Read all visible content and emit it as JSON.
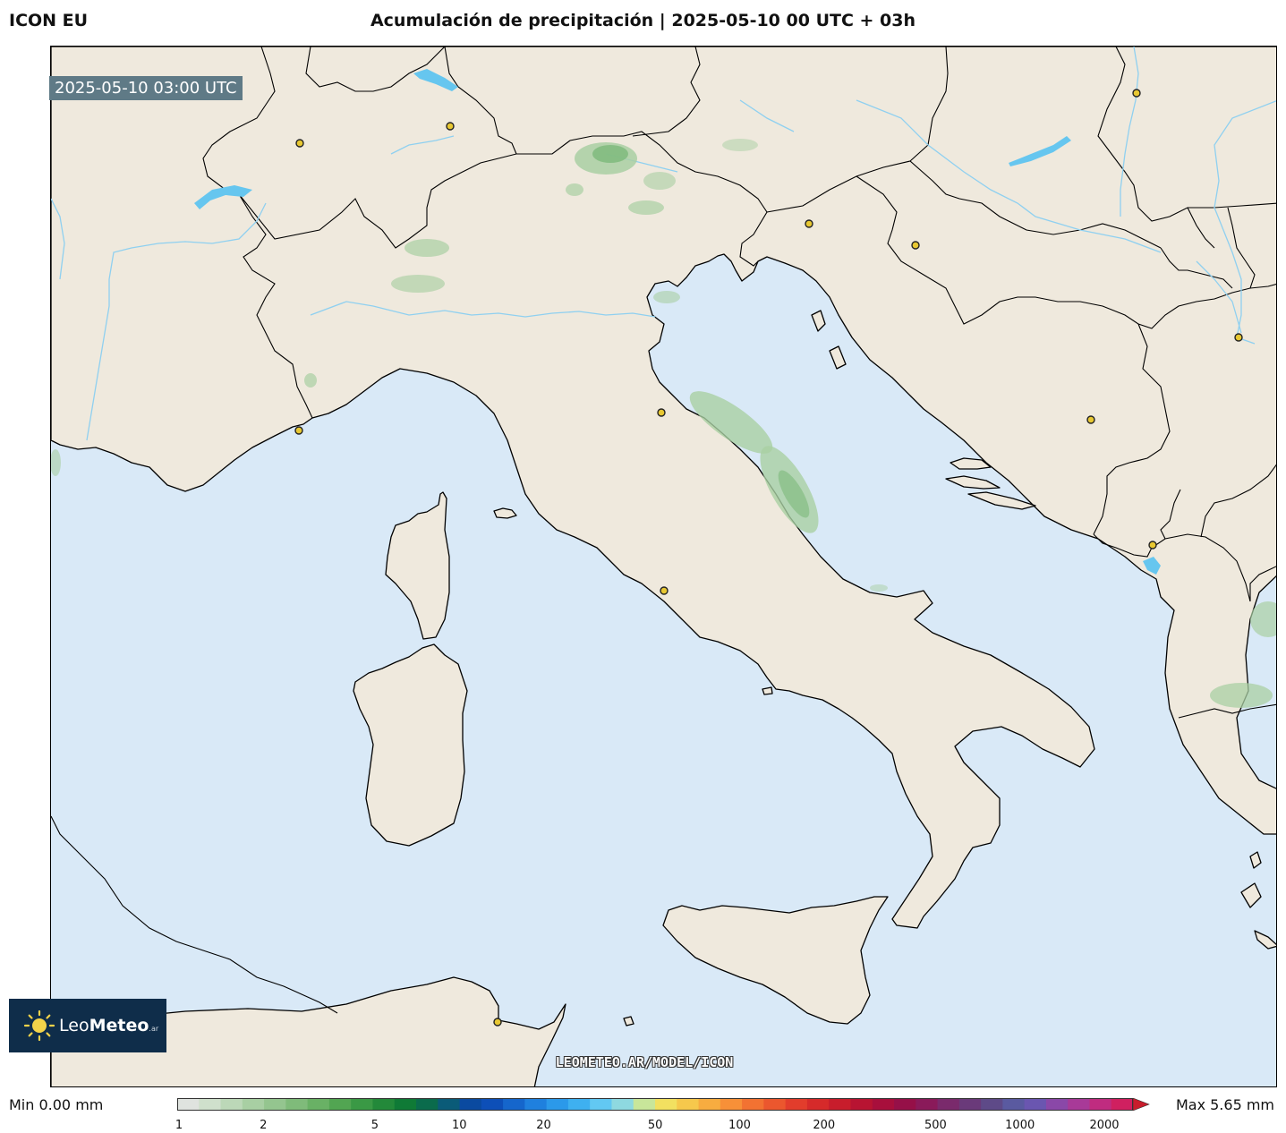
{
  "header": {
    "model": "ICON EU",
    "title": "Acumulación de precipitación | 2025-05-10 00 UTC + 03h"
  },
  "map": {
    "valid_time": "2025-05-10 03:00 UTC",
    "watermark": "LEOMETEO.AR/MODEL/ICON",
    "colors": {
      "sea": "#d9e9f7",
      "land": "#efe9dd",
      "coastline": "#000000",
      "rivers": "#8fd0f0",
      "lakes": "#66c6ef",
      "precip_light": "#a9cfa3",
      "precip_mid": "#7cb97a",
      "city_marker": "#e8c832"
    }
  },
  "logo": {
    "name_light": "Leo",
    "name_bold": "Meteo",
    "suffix": ".ar"
  },
  "colorbar": {
    "min_label": "Min 0.00 mm",
    "max_label": "Max 5.65 mm",
    "tick_labels": [
      "1",
      "2",
      "5",
      "10",
      "20",
      "50",
      "100",
      "200",
      "500",
      "1000",
      "2000"
    ],
    "scale": "log",
    "colors": [
      "#dfe3df",
      "#cfe0cc",
      "#bcd8b8",
      "#a8cfa3",
      "#94c58f",
      "#7fbb7a",
      "#69b165",
      "#52a552",
      "#3a9945",
      "#23893a",
      "#0f7a36",
      "#0a6b4c",
      "#0a5b78",
      "#0a4aa0",
      "#0d4fb8",
      "#1566cc",
      "#1f80de",
      "#2b99ea",
      "#3eb0f0",
      "#62c8f2",
      "#8ed9e0",
      "#c8e69a",
      "#f2e060",
      "#f6c84c",
      "#f7ac40",
      "#f79038",
      "#f27232",
      "#eb572e",
      "#e23d2c",
      "#d62a2a",
      "#c81d2c",
      "#b81432",
      "#a80f3c",
      "#961048",
      "#8a1a5a",
      "#7a2a6c",
      "#6a3a7a",
      "#5e4a88",
      "#5a5aa0",
      "#6a56b0",
      "#8a48a8",
      "#a83a98",
      "#c02c80",
      "#d02060"
    ]
  }
}
